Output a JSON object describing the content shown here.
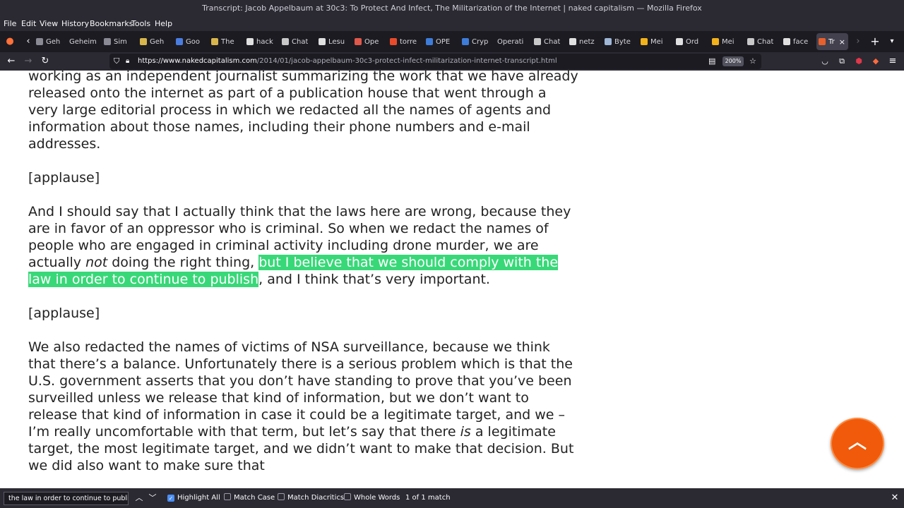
{
  "window": {
    "title": "Transcript: Jacob Appelbaum at 30c3: To Protect And Infect, The Militarization of the Internet | naked capitalism — Mozilla Firefox"
  },
  "menu": [
    "File",
    "Edit",
    "View",
    "History",
    "Bookmarks",
    "Tools",
    "Help"
  ],
  "tabs": [
    {
      "label": "Geh",
      "favicon": "generic-page-icon",
      "color": "#8a8a95"
    },
    {
      "label": "Geheim",
      "favicon": "none",
      "color": "#1c1b22"
    },
    {
      "label": "Sim",
      "favicon": "generic-page-icon",
      "color": "#8a8a95"
    },
    {
      "label": "Geh",
      "favicon": "bookmark-icon",
      "color": "#d9b64c"
    },
    {
      "label": "Goo",
      "favicon": "google-icon",
      "color": "#4a7de0"
    },
    {
      "label": "The",
      "favicon": "bookmark-icon",
      "color": "#d9b64c"
    },
    {
      "label": "hack",
      "favicon": "github-icon",
      "color": "#e0e0e0"
    },
    {
      "label": "Chat",
      "favicon": "openai-icon",
      "color": "#c8c8c8"
    },
    {
      "label": "Lesu",
      "favicon": "github-icon",
      "color": "#e0e0e0"
    },
    {
      "label": "Ope",
      "favicon": "generic-page-icon",
      "color": "#e0584a"
    },
    {
      "label": "torre",
      "favicon": "generic-page-icon",
      "color": "#e94b2a"
    },
    {
      "label": "OPE",
      "favicon": "vk-icon",
      "color": "#3d7cd9"
    },
    {
      "label": "Cryp",
      "favicon": "generic-page-icon",
      "color": "#3d7cd9"
    },
    {
      "label": "Operati",
      "favicon": "none",
      "color": "#1c1b22"
    },
    {
      "label": "Chat",
      "favicon": "openai-icon",
      "color": "#c8c8c8"
    },
    {
      "label": "netz",
      "favicon": "google-icon",
      "color": "#e0e0e0"
    },
    {
      "label": "Byte",
      "favicon": "generic-page-icon",
      "color": "#9fb6d6"
    },
    {
      "label": "Mei",
      "favicon": "generic-page-icon",
      "color": "#f2b21a"
    },
    {
      "label": "Ord",
      "favicon": "generic-page-icon",
      "color": "#e0e0e0"
    },
    {
      "label": "Mei",
      "favicon": "generic-page-icon",
      "color": "#f2b21a"
    },
    {
      "label": "Chat",
      "favicon": "openai-icon",
      "color": "#c8c8c8"
    },
    {
      "label": "face",
      "favicon": "google-icon",
      "color": "#e0e0e0"
    },
    {
      "label": "Tr",
      "favicon": "nc-icon",
      "color": "#e8602c",
      "active": true
    }
  ],
  "navbar": {
    "url_host": "https://www.nakedcapitalism.com",
    "url_path": "/2014/01/jacob-appelbaum-30c3-protect-infect-militarization-internet-transcript.html",
    "zoom": "200%"
  },
  "article": {
    "p0": "been released – just to be clear on the timeline, I’m not disclosing it first, I’m working as an independent journalist summarizing the work that we have already released onto the internet as part of a publication house that went through a very large editorial process in which we redacted all the names of agents and information about those names, including their phone numbers and e-mail addresses.",
    "applause1": "[applause]",
    "p2_a": "And I should say that I actually think that the laws here are wrong, because they are in favor of an oppressor who is criminal. So when we redact the names of people who are engaged in criminal activity including drone murder, we are actually ",
    "p2_em": "not",
    "p2_b": " doing the right thing, ",
    "p2_hl": "but I believe that we should comply with the law in order to continue to publish",
    "p2_c": ", and I think that’s very important.",
    "applause2": "[applause]",
    "p4_a": "We also redacted the names of victims of NSA surveillance, because we think that there’s a balance. Unfortunately there is a serious problem which is that the U.S. government asserts that you don’t have standing to prove that you’ve been surveilled unless we release that kind of information, but we don’t want to release that kind of information in case it could be a legitimate target, and we – I’m really uncomfortable with that term, but let’s say that there ",
    "p4_em": "is",
    "p4_b": " a legitimate target, the most legitimate target, and we didn’t want to make that decision. But we did also want to make sure that"
  },
  "findbar": {
    "query": "the law in order to continue to publish",
    "highlight_all": "Highlight All",
    "match_case": "Match Case",
    "match_diacritics": "Match Diacritics",
    "whole_words": "Whole Words",
    "result": "1 of 1 match"
  },
  "colors": {
    "highlight": "#38d878",
    "scroll_button": "#f05a0a",
    "chrome": "#2b2a33"
  }
}
